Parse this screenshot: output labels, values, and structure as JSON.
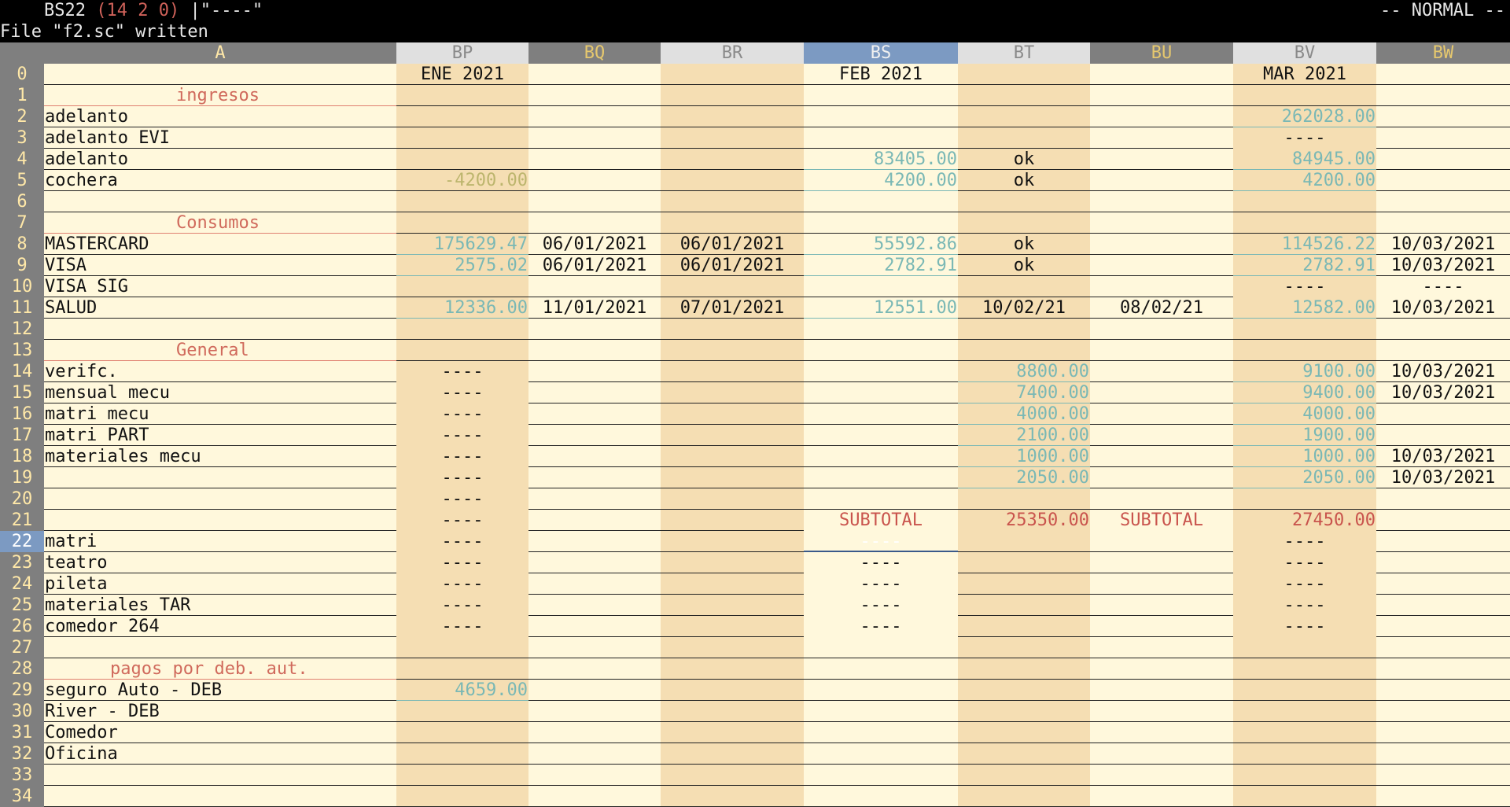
{
  "status": {
    "cell_ref": "BS22",
    "coords": "(14 2 0)",
    "cell_content": "|\"----\"",
    "mode": "-- NORMAL --"
  },
  "message": "File \"f2.sc\" written",
  "columns": [
    {
      "id": "A",
      "label": "A"
    },
    {
      "id": "BP",
      "label": "BP"
    },
    {
      "id": "BQ",
      "label": "BQ"
    },
    {
      "id": "BR",
      "label": "BR"
    },
    {
      "id": "BS",
      "label": "BS"
    },
    {
      "id": "BT",
      "label": "BT"
    },
    {
      "id": "BU",
      "label": "BU"
    },
    {
      "id": "BV",
      "label": "BV"
    },
    {
      "id": "BW",
      "label": "BW"
    }
  ],
  "colors": {
    "stripe_light": "#fff8dc",
    "stripe_dark": "#f5deb3",
    "header_bg": "#e0e0e0",
    "header_dark": "#7f7f7f",
    "selected": "#7c9ac2"
  },
  "rows": [
    {
      "n": "0",
      "cells": {
        "BP": "ENE 2021",
        "BS": "FEB 2021",
        "BV": "MAR 2021"
      }
    },
    {
      "n": "1",
      "cells": {
        "A": "ingresos"
      }
    },
    {
      "n": "2",
      "cells": {
        "A": "adelanto",
        "BV": "262028.00"
      }
    },
    {
      "n": "3",
      "cells": {
        "A": "adelanto EVI",
        "BV": "----"
      }
    },
    {
      "n": "4",
      "cells": {
        "A": "adelanto",
        "BS": "83405.00",
        "BT": "ok",
        "BV": "84945.00"
      }
    },
    {
      "n": "5",
      "cells": {
        "A": "cochera",
        "BP": "-4200.00",
        "BS": "4200.00",
        "BT": "ok",
        "BV": "4200.00"
      }
    },
    {
      "n": "6",
      "cells": {}
    },
    {
      "n": "7",
      "cells": {
        "A": "Consumos"
      }
    },
    {
      "n": "8",
      "cells": {
        "A": "MASTERCARD",
        "BP": "175629.47",
        "BQ": "06/01/2021",
        "BR": "06/01/2021",
        "BS": "55592.86",
        "BT": "ok",
        "BV": "114526.22",
        "BW": "10/03/2021"
      }
    },
    {
      "n": "9",
      "cells": {
        "A": "VISA",
        "BP": "2575.02",
        "BQ": "06/01/2021",
        "BR": "06/01/2021",
        "BS": "2782.91",
        "BT": "ok",
        "BV": "2782.91",
        "BW": "10/03/2021"
      }
    },
    {
      "n": "10",
      "cells": {
        "A": "VISA SIG",
        "BV": "----",
        "BW": "----"
      }
    },
    {
      "n": "11",
      "cells": {
        "A": "SALUD",
        "BP": "12336.00",
        "BQ": "11/01/2021",
        "BR": "07/01/2021",
        "BS": "12551.00",
        "BT": "10/02/21",
        "BU": "08/02/21",
        "BV": "12582.00",
        "BW": "10/03/2021"
      }
    },
    {
      "n": "12",
      "cells": {}
    },
    {
      "n": "13",
      "cells": {
        "A": "General"
      }
    },
    {
      "n": "14",
      "cells": {
        "A": "verifc.",
        "BP": "----",
        "BT": "8800.00",
        "BV": "9100.00",
        "BW": "10/03/2021"
      }
    },
    {
      "n": "15",
      "cells": {
        "A": "mensual mecu",
        "BP": "----",
        "BT": "7400.00",
        "BV": "9400.00",
        "BW": "10/03/2021"
      }
    },
    {
      "n": "16",
      "cells": {
        "A": "matri mecu",
        "BP": "----",
        "BT": "4000.00",
        "BV": "4000.00"
      }
    },
    {
      "n": "17",
      "cells": {
        "A": "matri PART",
        "BP": "----",
        "BT": "2100.00",
        "BV": "1900.00"
      }
    },
    {
      "n": "18",
      "cells": {
        "A": "materiales mecu",
        "BP": "----",
        "BT": "1000.00",
        "BV": "1000.00",
        "BW": "10/03/2021"
      }
    },
    {
      "n": "19",
      "cells": {
        "BP": "----",
        "BT": "2050.00",
        "BV": "2050.00",
        "BW": "10/03/2021"
      }
    },
    {
      "n": "20",
      "cells": {
        "BP": "----"
      }
    },
    {
      "n": "21",
      "cells": {
        "BP": "----",
        "BS": "SUBTOTAL",
        "BT": "25350.00",
        "BU": "SUBTOTAL",
        "BV": "27450.00"
      }
    },
    {
      "n": "22",
      "cells": {
        "A": "matri",
        "BP": "----",
        "BS": "----",
        "BV": "----"
      }
    },
    {
      "n": "23",
      "cells": {
        "A": "teatro",
        "BP": "----",
        "BS": "----",
        "BV": "----"
      }
    },
    {
      "n": "24",
      "cells": {
        "A": "pileta",
        "BP": "----",
        "BS": "----",
        "BV": "----"
      }
    },
    {
      "n": "25",
      "cells": {
        "A": "materiales TAR",
        "BP": "----",
        "BS": "----",
        "BV": "----"
      }
    },
    {
      "n": "26",
      "cells": {
        "A": "comedor 264",
        "BP": "----",
        "BS": "----",
        "BV": "----"
      }
    },
    {
      "n": "27",
      "cells": {}
    },
    {
      "n": "28",
      "cells": {
        "A": "pagos por deb. aut."
      }
    },
    {
      "n": "29",
      "cells": {
        "A": "seguro Auto - DEB",
        "BP": "4659.00"
      }
    },
    {
      "n": "30",
      "cells": {
        "A": "River - DEB"
      }
    },
    {
      "n": "31",
      "cells": {
        "A": "Comedor"
      }
    },
    {
      "n": "32",
      "cells": {
        "A": "Oficina"
      }
    },
    {
      "n": "33",
      "cells": {}
    },
    {
      "n": "34",
      "cells": {}
    }
  ]
}
